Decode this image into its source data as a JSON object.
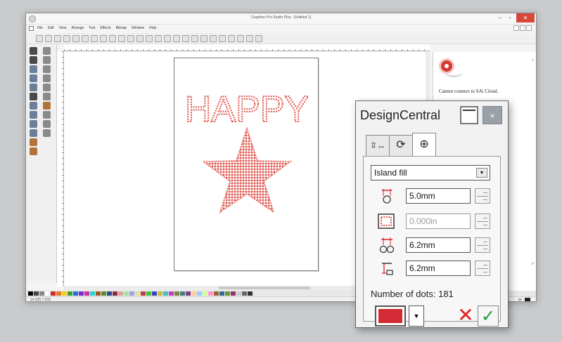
{
  "window": {
    "title": "Graphtec Pro Studio Plus - [Untitled 1]",
    "minimize_glyph": "–",
    "maximize_glyph": "▫",
    "close_glyph": "✕"
  },
  "menu": [
    "File",
    "Edit",
    "View",
    "Arrange",
    "Text",
    "Effects",
    "Bitmap",
    "Window",
    "Help"
  ],
  "design": {
    "text": "HAPPY",
    "fill_color": "#e0574f",
    "shape": "star"
  },
  "status_bar": {
    "left": "14.925   7.910",
    "right": "ial"
  },
  "cloud_panel": {
    "message": "Cannot connect to SAi Cloud."
  },
  "design_central": {
    "title": "DesignCentral",
    "close_glyph": "×",
    "tabs": [
      {
        "icon": "placement-icon",
        "glyph": "⇳↔"
      },
      {
        "icon": "rotate-icon",
        "glyph": "⟳"
      },
      {
        "icon": "rhinestone-target-icon",
        "glyph": "⊕"
      }
    ],
    "fill_type": "Island fill",
    "fields": [
      {
        "icon": "stone-size-icon",
        "value": "5.0mm",
        "disabled": false
      },
      {
        "icon": "outline-offset-icon",
        "value": "0.000in",
        "disabled": true
      },
      {
        "icon": "stone-spacing-icon",
        "value": "6.2mm",
        "disabled": false
      },
      {
        "icon": "row-spacing-icon",
        "value": "6.2mm",
        "disabled": false
      }
    ],
    "number_of_dots": "Number of dots: 181",
    "color": "#d42a35",
    "dropdown_glyph": "▼",
    "cancel_glyph": "✕",
    "ok_glyph": "✓"
  },
  "palette_colors": [
    "#000000",
    "#444444",
    "#888888",
    "#ffffff",
    "#d22a2a",
    "#e87a2a",
    "#f0d020",
    "#3aa03a",
    "#2a6ad2",
    "#7a2ad2",
    "#d22aa0",
    "#2ad2d2",
    "#a05a2a",
    "#5a8a2a",
    "#2a4a8a",
    "#8a2a4a",
    "#e0a0a0",
    "#a0e0a0",
    "#a0a0e0",
    "#e0e0a0",
    "#c04040",
    "#40c040",
    "#4040c0",
    "#c0c040",
    "#40c0c0",
    "#c040c0",
    "#808040",
    "#408080",
    "#804080",
    "#ffcc99",
    "#99ccff",
    "#ccff99",
    "#ff99cc",
    "#996633",
    "#336699",
    "#669933",
    "#993366",
    "#cccccc",
    "#666666",
    "#333333"
  ]
}
